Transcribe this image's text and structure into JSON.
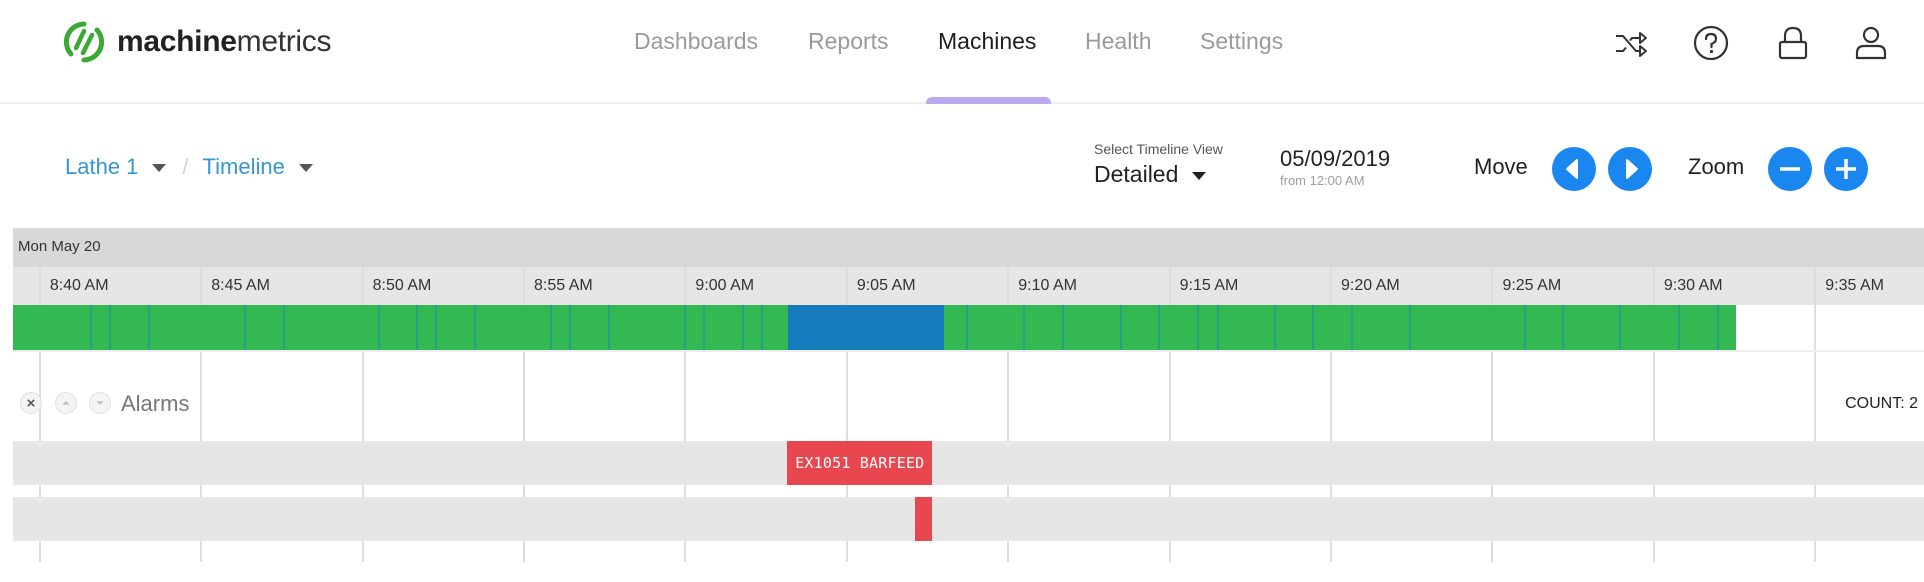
{
  "app": {
    "brand_bold": "machine",
    "brand_light": "metrics",
    "brand_color": "#3aaa35"
  },
  "nav": {
    "items": [
      {
        "label": "Dashboards",
        "active": false
      },
      {
        "label": "Reports",
        "active": false
      },
      {
        "label": "Machines",
        "active": true
      },
      {
        "label": "Health",
        "active": false
      },
      {
        "label": "Settings",
        "active": false
      }
    ],
    "active_indicator_color": "#bba8ee"
  },
  "header_icons": [
    "shuffle-icon",
    "help-icon",
    "lock-icon",
    "user-icon"
  ],
  "breadcrumb": {
    "machine": "Lathe 1",
    "separator": "/",
    "view": "Timeline"
  },
  "timeline_view": {
    "label": "Select Timeline View",
    "value": "Detailed"
  },
  "date": {
    "value": "05/09/2019",
    "sub": "from 12:00 AM"
  },
  "controls": {
    "move_label": "Move",
    "zoom_label": "Zoom",
    "button_color": "#1a86ef"
  },
  "timeline": {
    "day_label": "Mon May 20",
    "range_start": "8:39:12",
    "minutes_visible": 59.2,
    "ticks": [
      "8:40 AM",
      "8:45 AM",
      "8:50 AM",
      "8:55 AM",
      "9:00 AM",
      "9:05 AM",
      "9:10 AM",
      "9:15 AM",
      "9:20 AM",
      "9:25 AM",
      "9:30 AM",
      "9:35 AM"
    ],
    "tick_times": [
      "8:40:00",
      "8:45:00",
      "8:50:00",
      "8:55:00",
      "9:00:00",
      "9:05:00",
      "9:10:00",
      "9:15:00",
      "9:20:00",
      "9:25:00",
      "9:30:00",
      "9:35:00"
    ],
    "status_colors": {
      "running": "#33b852",
      "idle": "#157bbd"
    },
    "segments": [
      {
        "state": "running",
        "start": "8:39:12",
        "end": "9:03:13"
      },
      {
        "state": "idle",
        "start": "9:03:13",
        "end": "9:08:03"
      },
      {
        "state": "running",
        "start": "9:08:03",
        "end": "9:32:34"
      }
    ],
    "cycle_marks": [
      "8:41:37",
      "8:42:12",
      "8:43:25",
      "8:46:23",
      "8:47:35",
      "8:50:32",
      "8:51:43",
      "8:52:19",
      "8:53:31",
      "8:55:52",
      "8:56:28",
      "8:57:40",
      "9:00:01",
      "9:00:37",
      "9:01:49",
      "9:02:25",
      "9:08:46",
      "9:10:32",
      "9:11:44",
      "9:13:32",
      "9:14:43",
      "9:15:54",
      "9:16:31",
      "9:18:17",
      "9:19:29",
      "9:20:40",
      "9:22:28",
      "9:26:02",
      "9:27:13",
      "9:28:59",
      "9:30:49",
      "9:32:01"
    ]
  },
  "alarms": {
    "title": "Alarms",
    "count_label": "COUNT: 2",
    "color": "#e8474f",
    "items": [
      {
        "label": "EX1051 BARFEED",
        "start": "9:03:11",
        "end": "9:07:41"
      },
      {
        "label": "",
        "start": "9:07:08",
        "end": "9:07:41"
      }
    ]
  }
}
